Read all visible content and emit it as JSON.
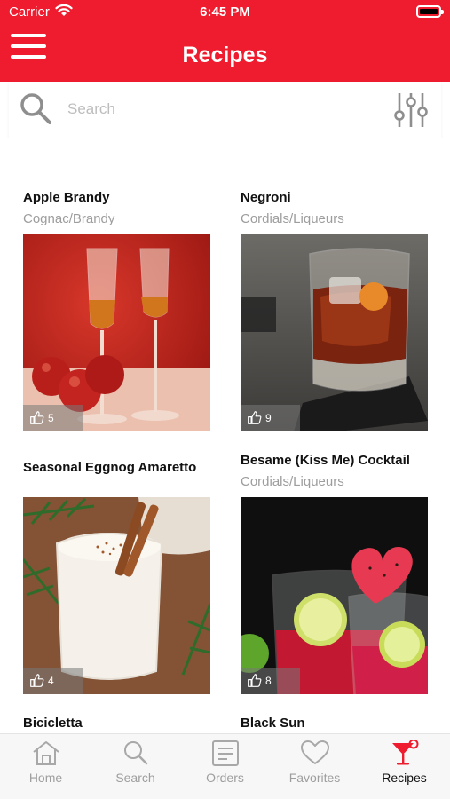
{
  "status_bar": {
    "carrier": "Carrier",
    "time": "6:45 PM"
  },
  "header": {
    "title": "Recipes",
    "menu_icon": "hamburger-menu-icon",
    "bg_color": "#ee1c2e"
  },
  "search": {
    "placeholder": "Search",
    "value": "",
    "icon": "search-icon",
    "filter_icon": "sliders-filter-icon"
  },
  "recipes": [
    {
      "title": "Apple Brandy",
      "category": "Cognac/Brandy",
      "likes": "5"
    },
    {
      "title": "Negroni",
      "category": "Cordials/Liqueurs",
      "likes": "9"
    },
    {
      "title": "Seasonal Eggnog Amaretto",
      "category": "",
      "likes": "4"
    },
    {
      "title": "Besame (Kiss Me) Cocktail",
      "category": "Cordials/Liqueurs",
      "likes": "8"
    },
    {
      "title": "Bicicletta",
      "category": ""
    },
    {
      "title": "Black Sun",
      "category": ""
    }
  ],
  "tabbar": {
    "tabs": [
      {
        "label": "Home",
        "icon": "home-icon"
      },
      {
        "label": "Search",
        "icon": "search-icon"
      },
      {
        "label": "Orders",
        "icon": "orders-list-icon"
      },
      {
        "label": "Favorites",
        "icon": "heart-icon"
      },
      {
        "label": "Recipes",
        "icon": "cocktail-glass-icon",
        "active": true
      }
    ],
    "active_color": "#ee1c2e"
  }
}
